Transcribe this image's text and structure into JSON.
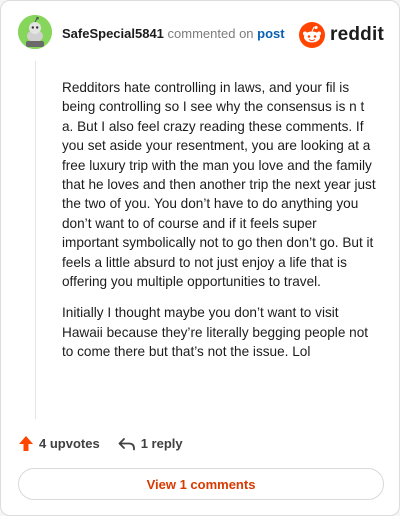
{
  "comment": {
    "username": "SafeSpecial5841",
    "commented_on_text": "commented on",
    "post_link_text": "post",
    "avatar_color": "#86d65c",
    "paragraphs": [
      "Redditors hate controlling in laws, and your fil is being controlling so I see why the consensus is n t a. But I also feel crazy reading these comments. If you set aside your resentment, you are looking at a free luxury trip with the man you love and the family that he loves and then another trip the next year just the two of you. You don’t have to do anything you don’t want to of course and if it feels super important symbolically not to go then don’t go. But it feels a little absurd to not just enjoy a life that is offering you multiple opportunities to travel.",
      "Initially I thought maybe you don’t want to visit Hawaii because they’re literally begging people not to come there but that’s not the issue. Lol"
    ]
  },
  "brand": {
    "wordmark": "reddit",
    "icon": "reddit-logo-icon",
    "color": "#ff4500"
  },
  "actions": {
    "upvotes_label": "4 upvotes",
    "reply_label": "1 reply",
    "upvote_icon": "upvote-arrow-icon",
    "reply_icon": "reply-arrow-icon"
  },
  "view_comments_label": "View 1 comments",
  "colors": {
    "accent": "#d93a00",
    "link": "#0a5fb3"
  }
}
